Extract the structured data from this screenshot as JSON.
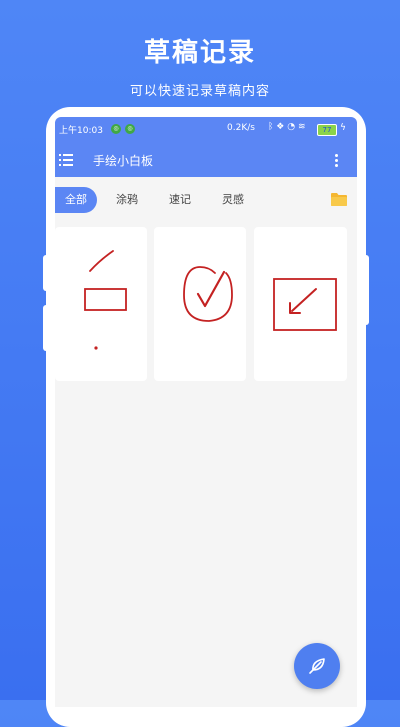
{
  "promo": {
    "title": "草稿记录",
    "subtitle": "可以快速记录草稿内容"
  },
  "status_bar": {
    "time": "上午10:03",
    "network_speed": "0.2K/s",
    "battery": "77"
  },
  "app_bar": {
    "title": "手绘小白板",
    "menu_icon": "hamburger-menu-icon",
    "more_icon": "more-vert-icon"
  },
  "tabs": [
    {
      "label": "全部",
      "active": true
    },
    {
      "label": "涂鸦",
      "active": false
    },
    {
      "label": "速记",
      "active": false
    },
    {
      "label": "灵感",
      "active": false
    }
  ],
  "folder_icon": "folder-icon",
  "sketches": [
    {
      "content": "line, rectangle and dot sketch"
    },
    {
      "content": "checkmark in circle sketch"
    },
    {
      "content": "arrow in rectangle sketch"
    }
  ],
  "fab": {
    "icon": "feather-pen-icon"
  },
  "colors": {
    "background": "#4f86f6",
    "app_bar": "#5b86f4",
    "sketch_ink": "#c42222",
    "folder": "#f5b731",
    "battery": "#8bd34a"
  }
}
